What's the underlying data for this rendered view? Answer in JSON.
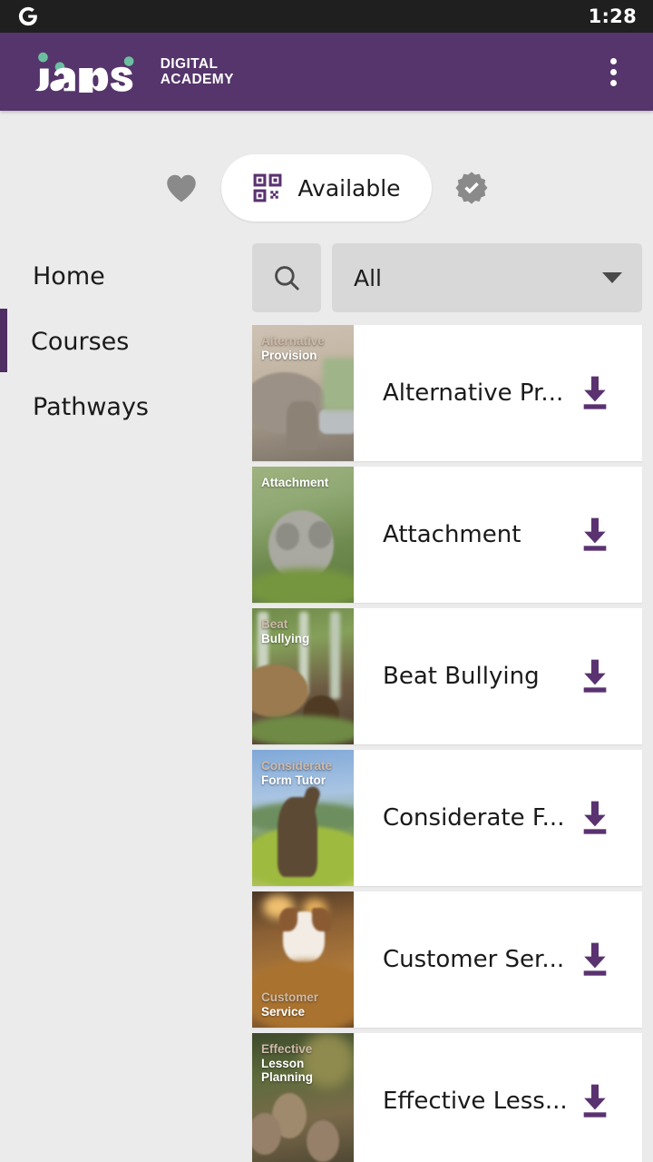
{
  "status_bar": {
    "app_icon": "google-g-icon",
    "time": "1:28"
  },
  "app_bar": {
    "brand_word": "iaps",
    "brand_line1": "DIGITAL",
    "brand_line2": "ACADEMY",
    "overflow_icon": "more-vertical-icon",
    "background_color": "#55356b"
  },
  "tabs": {
    "favorites": {
      "icon": "heart-icon",
      "active": false
    },
    "available": {
      "icon": "qr-code-icon",
      "label": "Available",
      "active": true
    },
    "completed": {
      "icon": "verified-badge-icon",
      "active": false
    }
  },
  "sidebar": {
    "items": [
      {
        "label": "Home",
        "active": false
      },
      {
        "label": "Courses",
        "active": true
      },
      {
        "label": "Pathways",
        "active": false
      }
    ],
    "active_indicator_color": "#4f2f63"
  },
  "filters": {
    "search_icon": "search-icon",
    "category_value": "All",
    "caret_icon": "chevron-down-icon"
  },
  "courses": [
    {
      "title": "Alternative Pr...",
      "thumb_label": [
        "Alternative",
        "Provision"
      ],
      "thumb_label_position": "top",
      "thumb_art": "elephant-in-living-room",
      "action_icon": "download-icon"
    },
    {
      "title": "Attachment",
      "thumb_label": [
        "Attachment"
      ],
      "thumb_label_position": "top",
      "thumb_art": "koala-on-branch",
      "action_icon": "download-icon"
    },
    {
      "title": "Beat Bullying",
      "thumb_label": [
        "Beat",
        "Bullying"
      ],
      "thumb_label_position": "top",
      "thumb_art": "bear-and-cub-in-forest",
      "action_icon": "download-icon"
    },
    {
      "title": "Considerate F...",
      "thumb_label": [
        "Considerate",
        "Form Tutor"
      ],
      "thumb_label_position": "top",
      "thumb_art": "bear-cub-in-meadow",
      "action_icon": "download-icon"
    },
    {
      "title": "Customer Ser...",
      "thumb_label": [
        "Customer",
        "Service"
      ],
      "thumb_label_position": "bottom",
      "thumb_art": "dog-in-autumn-leaves",
      "action_icon": "download-icon"
    },
    {
      "title": "Effective Less...",
      "thumb_label": [
        "Effective",
        "Lesson",
        "Planning"
      ],
      "thumb_label_position": "top",
      "thumb_art": "otters",
      "action_icon": "download-icon"
    }
  ],
  "colors": {
    "brand_purple": "#55356b",
    "accent_purple": "#4f2f63",
    "page_background": "#ebebeb",
    "card_background": "#ffffff",
    "logo_dot_green": "#6bbfa0"
  }
}
